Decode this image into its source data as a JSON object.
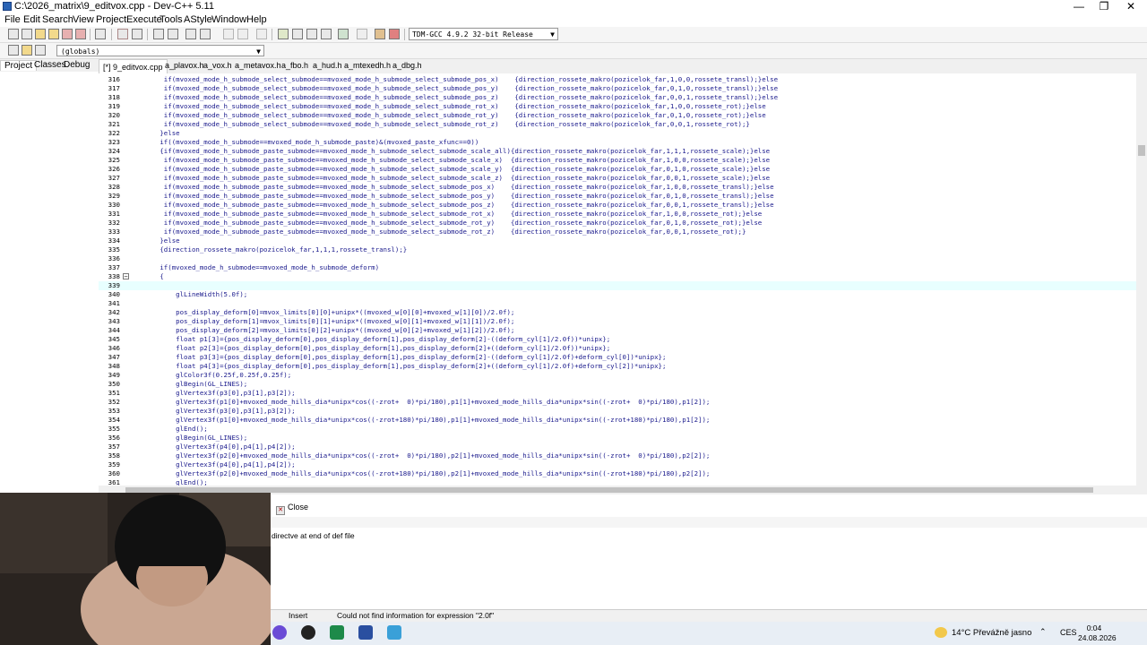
{
  "window": {
    "title": "C:\\2026_matrix\\9_editvox.cpp - Dev-C++ 5.11",
    "minimize": "—",
    "restore": "❐",
    "close": "✕"
  },
  "menu": [
    "File",
    "Edit",
    "Search",
    "View",
    "Project",
    "Execute",
    "Tools",
    "AStyle",
    "Window",
    "Help"
  ],
  "toolbar": {
    "compiler": "TDM-GCC 4.9.2 32-bit Release",
    "scope": "(globals)"
  },
  "left_tabs": [
    "Project",
    "Classes",
    "Debug"
  ],
  "file_tabs": [
    "[*] 9_editvox.cpp",
    "a_plavox.h",
    "a_vox.h",
    "a_metavox.h",
    "a_fbo.h",
    "a_hud.h",
    "a_mtexedh.h",
    "a_dbg.h"
  ],
  "editor": {
    "lines": [
      {
        "n": "316",
        "code": "    if(mvoxed_mode_h_submode_select_submode==mvoxed_mode_h_submode_select_submode_pos_x)    {direction_rossete_makro(pozicelok_far,1,0,0,rossete_transl);}else"
      },
      {
        "n": "317",
        "code": "    if(mvoxed_mode_h_submode_select_submode==mvoxed_mode_h_submode_select_submode_pos_y)    {direction_rossete_makro(pozicelok_far,0,1,0,rossete_transl);}else"
      },
      {
        "n": "318",
        "code": "    if(mvoxed_mode_h_submode_select_submode==mvoxed_mode_h_submode_select_submode_pos_z)    {direction_rossete_makro(pozicelok_far,0,0,1,rossete_transl);}else"
      },
      {
        "n": "319",
        "code": "    if(mvoxed_mode_h_submode_select_submode==mvoxed_mode_h_submode_select_submode_rot_x)    {direction_rossete_makro(pozicelok_far,1,0,0,rossete_rot);}else"
      },
      {
        "n": "320",
        "code": "    if(mvoxed_mode_h_submode_select_submode==mvoxed_mode_h_submode_select_submode_rot_y)    {direction_rossete_makro(pozicelok_far,0,1,0,rossete_rot);}else"
      },
      {
        "n": "321",
        "code": "    if(mvoxed_mode_h_submode_select_submode==mvoxed_mode_h_submode_select_submode_rot_z)    {direction_rossete_makro(pozicelok_far,0,0,1,rossete_rot);}"
      },
      {
        "n": "322",
        "code": "   }else"
      },
      {
        "n": "323",
        "code": "   if((mvoxed_mode_h_submode==mvoxed_mode_h_submode_paste)&(mvoxed_paste_xfunc==0))"
      },
      {
        "n": "324",
        "code": "   {if(mvoxed_mode_h_submode_paste_submode==mvoxed_mode_h_submode_select_submode_scale_all){direction_rossete_makro(pozicelok_far,1,1,1,rossete_scale);}else"
      },
      {
        "n": "325",
        "code": "    if(mvoxed_mode_h_submode_paste_submode==mvoxed_mode_h_submode_select_submode_scale_x)  {direction_rossete_makro(pozicelok_far,1,0,0,rossete_scale);}else"
      },
      {
        "n": "326",
        "code": "    if(mvoxed_mode_h_submode_paste_submode==mvoxed_mode_h_submode_select_submode_scale_y)  {direction_rossete_makro(pozicelok_far,0,1,0,rossete_scale);}else"
      },
      {
        "n": "327",
        "code": "    if(mvoxed_mode_h_submode_paste_submode==mvoxed_mode_h_submode_select_submode_scale_z)  {direction_rossete_makro(pozicelok_far,0,0,1,rossete_scale);}else"
      },
      {
        "n": "328",
        "code": "    if(mvoxed_mode_h_submode_paste_submode==mvoxed_mode_h_submode_select_submode_pos_x)    {direction_rossete_makro(pozicelok_far,1,0,0,rossete_transl);}else"
      },
      {
        "n": "329",
        "code": "    if(mvoxed_mode_h_submode_paste_submode==mvoxed_mode_h_submode_select_submode_pos_y)    {direction_rossete_makro(pozicelok_far,0,1,0,rossete_transl);}else"
      },
      {
        "n": "330",
        "code": "    if(mvoxed_mode_h_submode_paste_submode==mvoxed_mode_h_submode_select_submode_pos_z)    {direction_rossete_makro(pozicelok_far,0,0,1,rossete_transl);}else"
      },
      {
        "n": "331",
        "code": "    if(mvoxed_mode_h_submode_paste_submode==mvoxed_mode_h_submode_select_submode_rot_x)    {direction_rossete_makro(pozicelok_far,1,0,0,rossete_rot);}else"
      },
      {
        "n": "332",
        "code": "    if(mvoxed_mode_h_submode_paste_submode==mvoxed_mode_h_submode_select_submode_rot_y)    {direction_rossete_makro(pozicelok_far,0,1,0,rossete_rot);}else"
      },
      {
        "n": "333",
        "code": "    if(mvoxed_mode_h_submode_paste_submode==mvoxed_mode_h_submode_select_submode_rot_z)    {direction_rossete_makro(pozicelok_far,0,0,1,rossete_rot);}"
      },
      {
        "n": "334",
        "code": "   }else"
      },
      {
        "n": "335",
        "code": "   {direction_rossete_makro(pozicelok_far,1,1,1,rossete_transl);}"
      },
      {
        "n": "336",
        "code": ""
      },
      {
        "n": "337",
        "code": "   if(mvoxed_mode_h_submode==mvoxed_mode_h_submode_deform)"
      },
      {
        "n": "338",
        "code": "   {"
      },
      {
        "n": "339",
        "code": "    "
      },
      {
        "n": "340",
        "code": "       glLineWidth(5.0f);"
      },
      {
        "n": "341",
        "code": ""
      },
      {
        "n": "342",
        "code": "       pos_display_deform[0]=mvox_limits[0][0]+unipx*((mvoxed_w[0][0]+mvoxed_w[1][0])/2.0f);"
      },
      {
        "n": "343",
        "code": "       pos_display_deform[1]=mvox_limits[0][1]+unipx*((mvoxed_w[0][1]+mvoxed_w[1][1])/2.0f);"
      },
      {
        "n": "344",
        "code": "       pos_display_deform[2]=mvox_limits[0][2]+unipx*((mvoxed_w[0][2]+mvoxed_w[1][2])/2.0f);"
      },
      {
        "n": "345",
        "code": "       float p1[3]={pos_display_deform[0],pos_display_deform[1],pos_display_deform[2]-((deform_cyl[1]/2.0f))*unipx};"
      },
      {
        "n": "346",
        "code": "       float p2[3]={pos_display_deform[0],pos_display_deform[1],pos_display_deform[2]+((deform_cyl[1]/2.0f))*unipx};"
      },
      {
        "n": "347",
        "code": "       float p3[3]={pos_display_deform[0],pos_display_deform[1],pos_display_deform[2]-((deform_cyl[1]/2.0f)+deform_cyl[0])*unipx};"
      },
      {
        "n": "348",
        "code": "       float p4[3]={pos_display_deform[0],pos_display_deform[1],pos_display_deform[2]+((deform_cyl[1]/2.0f)+deform_cyl[2])*unipx};"
      },
      {
        "n": "349",
        "code": "       glColor3f(0.25f,0.25f,0.25f);"
      },
      {
        "n": "350",
        "code": "       glBegin(GL_LINES);"
      },
      {
        "n": "351",
        "code": "       glVertex3f(p3[0],p3[1],p3[2]);"
      },
      {
        "n": "352",
        "code": "       glVertex3f(p1[0]+mvoxed_mode_hills_dia*unipx*cos((-zrot+  0)*pi/180),p1[1]+mvoxed_mode_hills_dia*unipx*sin((-zrot+  0)*pi/180),p1[2]);"
      },
      {
        "n": "353",
        "code": "       glVertex3f(p3[0],p3[1],p3[2]);"
      },
      {
        "n": "354",
        "code": "       glVertex3f(p1[0]+mvoxed_mode_hills_dia*unipx*cos((-zrot+180)*pi/180),p1[1]+mvoxed_mode_hills_dia*unipx*sin((-zrot+180)*pi/180),p1[2]);"
      },
      {
        "n": "355",
        "code": "       glEnd();"
      },
      {
        "n": "356",
        "code": "       glBegin(GL_LINES);"
      },
      {
        "n": "357",
        "code": "       glVertex3f(p4[0],p4[1],p4[2]);"
      },
      {
        "n": "358",
        "code": "       glVertex3f(p2[0]+mvoxed_mode_hills_dia*unipx*cos((-zrot+  0)*pi/180),p2[1]+mvoxed_mode_hills_dia*unipx*sin((-zrot+  0)*pi/180),p2[2]);"
      },
      {
        "n": "359",
        "code": "       glVertex3f(p4[0],p4[1],p4[2]);"
      },
      {
        "n": "360",
        "code": "       glVertex3f(p2[0]+mvoxed_mode_hills_dia*unipx*cos((-zrot+180)*pi/180),p2[1]+mvoxed_mode_hills_dia*unipx*sin((-zrot+180)*pi/180),p2[2]);"
      },
      {
        "n": "361",
        "code": "       glEnd();"
      }
    ]
  },
  "bottom_panel": {
    "close_label": "Close",
    "message": "directve at end of def file"
  },
  "status": {
    "mode": "Insert",
    "message": "Could not find information for expression \"2.0f\""
  },
  "taskbar": {
    "weather": "14°C  Převážně jasno",
    "lang": "CES",
    "time": "0:04",
    "date": "24.08.2026"
  }
}
